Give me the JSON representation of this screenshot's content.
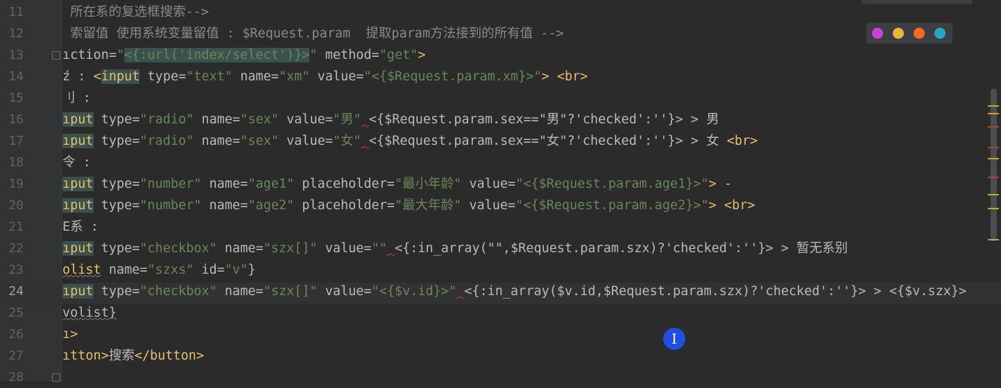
{
  "editor": {
    "lines": [
      {
        "num": "11",
        "active": false,
        "segs": [
          {
            "t": " 所在系的复选框搜索-->",
            "c": "c"
          }
        ]
      },
      {
        "num": "12",
        "active": false,
        "segs": [
          {
            "t": " 索留值 使用系统变量留值 : $Request.param  提取param方法接到的所有值 -->",
            "c": "c"
          }
        ]
      },
      {
        "num": "13",
        "active": false,
        "segs": [
          {
            "t": "ıction=",
            "c": "a"
          },
          {
            "t": "\"",
            "c": "s"
          },
          {
            "t": "<{:url('index/select')}>",
            "c": "s hl"
          },
          {
            "t": "\"",
            "c": "s"
          },
          {
            "t": " method=",
            "c": "a"
          },
          {
            "t": "\"get\"",
            "c": "s"
          },
          {
            "t": ">",
            "c": "t"
          }
        ]
      },
      {
        "num": "14",
        "active": false,
        "segs": [
          {
            "t": "ź : ",
            "c": "a"
          },
          {
            "t": "<",
            "c": "t"
          },
          {
            "t": "input",
            "c": "t hl"
          },
          {
            "t": " type=",
            "c": "a"
          },
          {
            "t": "\"text\"",
            "c": "s"
          },
          {
            "t": " name=",
            "c": "a"
          },
          {
            "t": "\"xm\"",
            "c": "s"
          },
          {
            "t": " value=",
            "c": "a"
          },
          {
            "t": "\"<{$Request.param.xm}>\"",
            "c": "s"
          },
          {
            "t": "> <br>",
            "c": "t"
          }
        ]
      },
      {
        "num": "15",
        "active": false,
        "segs": [
          {
            "t": "刂 :",
            "c": "a"
          }
        ]
      },
      {
        "num": "16",
        "active": false,
        "segs": [
          {
            "t": "ıput",
            "c": "t hl"
          },
          {
            "t": " type=",
            "c": "a"
          },
          {
            "t": "\"radio\"",
            "c": "s"
          },
          {
            "t": " name=",
            "c": "a"
          },
          {
            "t": "\"sex\"",
            "c": "s"
          },
          {
            "t": " value=",
            "c": "a"
          },
          {
            "t": "\"男\"",
            "c": "s"
          },
          {
            "t": " ",
            "c": "a sq"
          },
          {
            "t": "<{$Request.param.sex==\"男\"?'checked':''}>",
            "c": "a"
          },
          {
            "t": " > 男",
            "c": "a"
          }
        ]
      },
      {
        "num": "17",
        "active": false,
        "segs": [
          {
            "t": "ıput",
            "c": "t hl"
          },
          {
            "t": " type=",
            "c": "a"
          },
          {
            "t": "\"radio\"",
            "c": "s"
          },
          {
            "t": " name=",
            "c": "a"
          },
          {
            "t": "\"sex\"",
            "c": "s"
          },
          {
            "t": " value=",
            "c": "a"
          },
          {
            "t": "\"女\"",
            "c": "s"
          },
          {
            "t": " ",
            "c": "a sq"
          },
          {
            "t": "<{$Request.param.sex==\"女\"?'checked':''}>",
            "c": "a"
          },
          {
            "t": " > 女 ",
            "c": "a"
          },
          {
            "t": "<br>",
            "c": "t"
          }
        ]
      },
      {
        "num": "18",
        "active": false,
        "segs": [
          {
            "t": "令 :",
            "c": "a"
          }
        ]
      },
      {
        "num": "19",
        "active": false,
        "segs": [
          {
            "t": "ıput",
            "c": "t hl"
          },
          {
            "t": " type=",
            "c": "a"
          },
          {
            "t": "\"number\"",
            "c": "s"
          },
          {
            "t": " name=",
            "c": "a"
          },
          {
            "t": "\"age1\"",
            "c": "s"
          },
          {
            "t": " placeholder=",
            "c": "a"
          },
          {
            "t": "\"最小年龄\"",
            "c": "s"
          },
          {
            "t": " value=",
            "c": "a"
          },
          {
            "t": "\"<{$Request.param.age1}>\"",
            "c": "s"
          },
          {
            "t": "> -",
            "c": "t"
          }
        ]
      },
      {
        "num": "20",
        "active": false,
        "segs": [
          {
            "t": "ıput",
            "c": "t hl"
          },
          {
            "t": " type=",
            "c": "a"
          },
          {
            "t": "\"number\"",
            "c": "s"
          },
          {
            "t": " name=",
            "c": "a"
          },
          {
            "t": "\"age2\"",
            "c": "s"
          },
          {
            "t": " placeholder=",
            "c": "a"
          },
          {
            "t": "\"最大年龄\"",
            "c": "s"
          },
          {
            "t": " value=",
            "c": "a"
          },
          {
            "t": "\"<{$Request.param.age2}>\"",
            "c": "s"
          },
          {
            "t": "> <br>",
            "c": "t"
          }
        ]
      },
      {
        "num": "21",
        "active": false,
        "segs": [
          {
            "t": "E系 :",
            "c": "a"
          }
        ]
      },
      {
        "num": "22",
        "active": false,
        "segs": [
          {
            "t": "ıput",
            "c": "t hl"
          },
          {
            "t": " type=",
            "c": "a"
          },
          {
            "t": "\"checkbox\"",
            "c": "s"
          },
          {
            "t": " name=",
            "c": "a"
          },
          {
            "t": "\"szx[]\"",
            "c": "s"
          },
          {
            "t": " value=",
            "c": "a"
          },
          {
            "t": "\"\"",
            "c": "s"
          },
          {
            "t": " ",
            "c": "a sq"
          },
          {
            "t": "<{:in_array(\"\",$Request.param.szx)?'checked':''}>",
            "c": "a"
          },
          {
            "t": " > 暂无系别",
            "c": "a"
          }
        ]
      },
      {
        "num": "23",
        "active": false,
        "segs": [
          {
            "t": "olist",
            "c": "t sqg"
          },
          {
            "t": " name=",
            "c": "a"
          },
          {
            "t": "\"szxs\"",
            "c": "s"
          },
          {
            "t": " id=",
            "c": "a"
          },
          {
            "t": "\"v\"",
            "c": "s"
          },
          {
            "t": "}",
            "c": "a"
          }
        ]
      },
      {
        "num": "24",
        "active": true,
        "segs": [
          {
            "t": "ıput",
            "c": "t hl"
          },
          {
            "t": " type=",
            "c": "a"
          },
          {
            "t": "\"checkbox\"",
            "c": "s"
          },
          {
            "t": " name=",
            "c": "a"
          },
          {
            "t": "\"szx[]\"",
            "c": "s"
          },
          {
            "t": " value=",
            "c": "a"
          },
          {
            "t": "\"<{$v.id}>\"",
            "c": "s"
          },
          {
            "t": " ",
            "c": "a sq"
          },
          {
            "t": "<{:in_array($v.id,$Request.param.szx)?'checked':''}>",
            "c": "a"
          },
          {
            "t": " > <{$v.szx}>",
            "c": "a"
          }
        ]
      },
      {
        "num": "25",
        "active": false,
        "segs": [
          {
            "t": "volist}",
            "c": "a sqg"
          }
        ]
      },
      {
        "num": "26",
        "active": false,
        "segs": [
          {
            "t": "ı>",
            "c": "t"
          }
        ]
      },
      {
        "num": "27",
        "active": false,
        "segs": [
          {
            "t": "ıtton>",
            "c": "t"
          },
          {
            "t": "搜索",
            "c": "a"
          },
          {
            "t": "</button>",
            "c": "t"
          }
        ]
      },
      {
        "num": "28",
        "active": false,
        "segs": [
          {
            "t": "",
            "c": "a"
          }
        ]
      }
    ]
  },
  "browser_icons": [
    {
      "name": "phpstorm-icon",
      "color": "#c93fd8"
    },
    {
      "name": "chrome-icon",
      "color": "#e8b73a"
    },
    {
      "name": "firefox-icon",
      "color": "#f26b21"
    },
    {
      "name": "edge-icon",
      "color": "#2aa6c9"
    }
  ],
  "cursor": {
    "glyph": "I"
  },
  "colors": {
    "tag": "#e8bf6a",
    "string": "#6a8759",
    "comment": "#8a8a8a",
    "text": "#bababa",
    "background": "#2b2b2b",
    "gutter": "#313335"
  }
}
